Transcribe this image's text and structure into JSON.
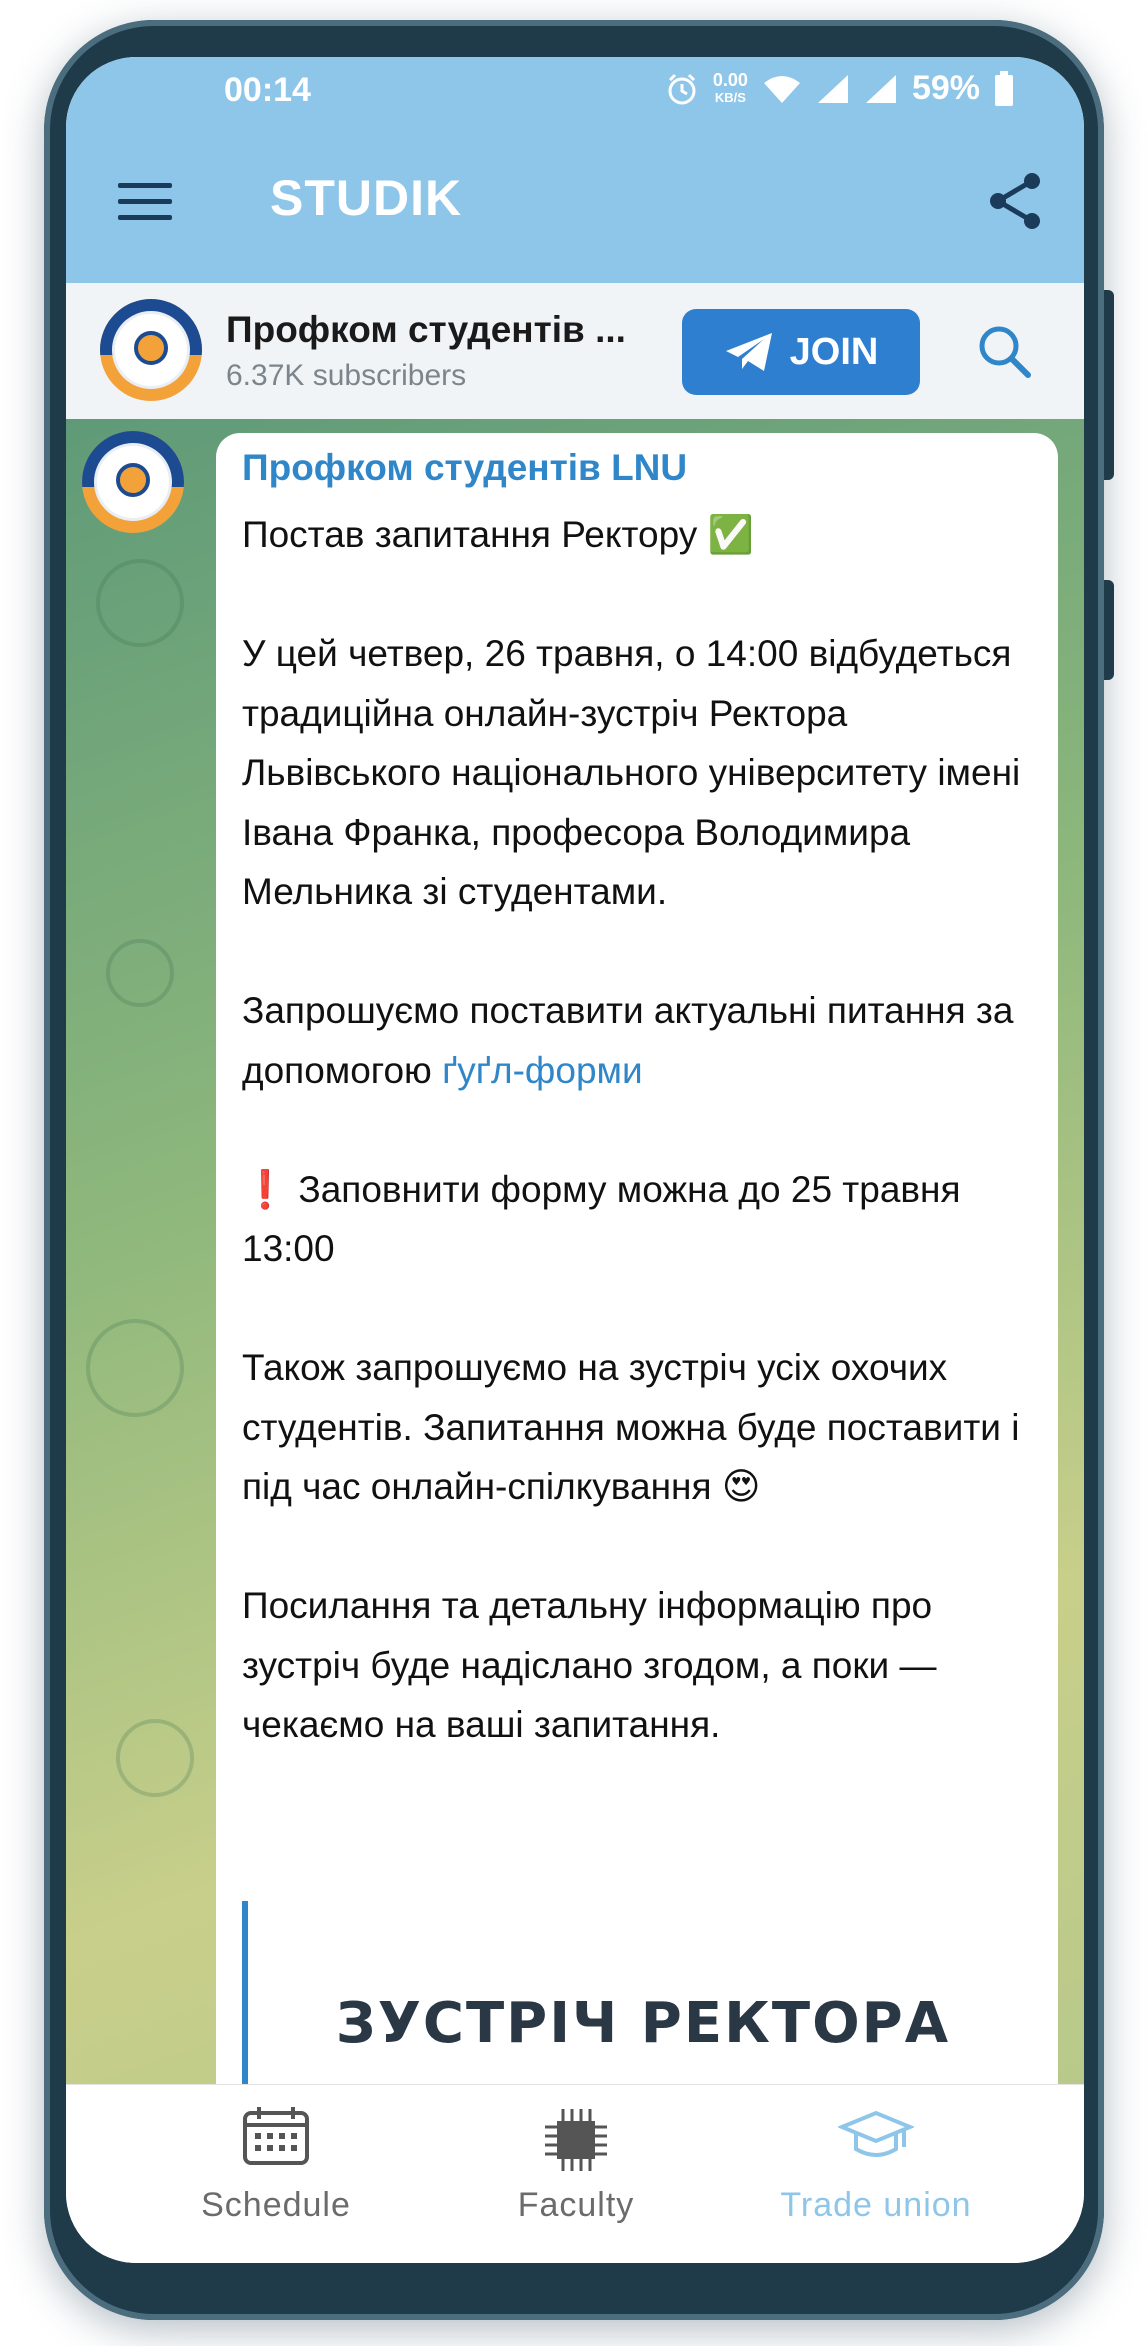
{
  "status_bar": {
    "time": "00:14",
    "network_speed": "0.00",
    "speed_unit": "KB/S",
    "battery": "59%"
  },
  "app": {
    "title": "STUDIK",
    "menu_icon": "hamburger-menu-icon",
    "share_icon": "share-icon"
  },
  "channel": {
    "name": "Профком студентів ...",
    "subscribers": "6.37K subscribers",
    "join_label": "JOIN",
    "search_icon": "search-icon"
  },
  "message": {
    "sender": "Профком студентів LNU",
    "line_title": "Постав запитання Ректору",
    "title_emoji": "✅",
    "para1": "У цей четвер, 26 травня, о 14:00 відбудеться традиційна онлайн-зустріч Ректора Львівського національного університету імені Івана Франка, професора Володимира Мельника зі студентами.",
    "para2_prefix": "Запрошуємо поставити актуальні питання за допомогою ",
    "para2_link": "ґуґл-форми",
    "para3_emoji": "❗",
    "para3": "Заповнити форму можна до 25 травня 13:00",
    "para4": "Також запрошуємо на зустріч усіх охочих студентів. Запитання можна буде поставити і під час онлайн-спілкування",
    "para4_emoji": "😍",
    "para5": "Посилання та детальну інформацію про зустріч буде надіслано згодом, а поки — чекаємо на ваші запитання.",
    "preview_title": "ЗУСТРІЧ РЕКТОРА"
  },
  "bottom_nav": {
    "items": [
      {
        "label": "Schedule",
        "icon": "calendar-icon",
        "active": false
      },
      {
        "label": "Faculty",
        "icon": "chip-icon",
        "active": false
      },
      {
        "label": "Trade union",
        "icon": "graduation-cap-icon",
        "active": true
      }
    ]
  },
  "colors": {
    "topbar": "#8ec6ea",
    "accent": "#2f7fd1",
    "link": "#2f86c8"
  }
}
